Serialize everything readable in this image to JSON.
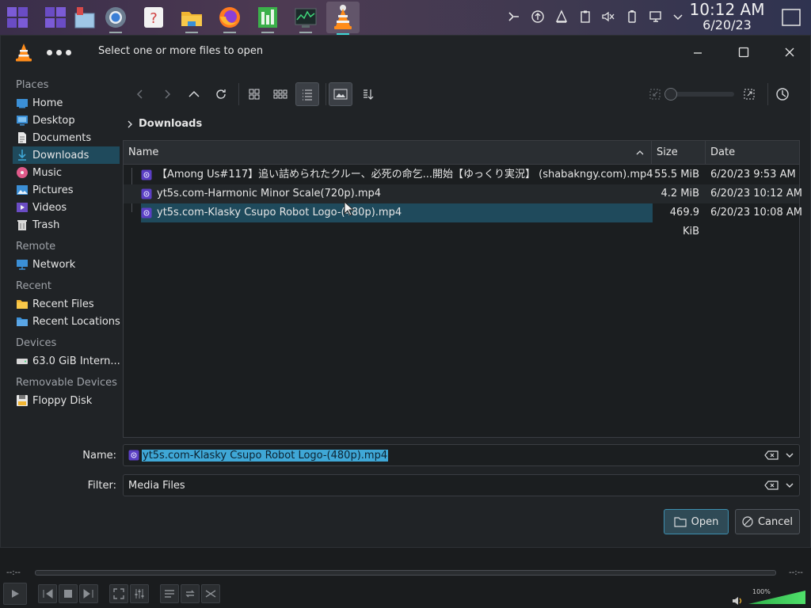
{
  "taskbar": {
    "apps": [
      "pager-icon",
      "pager-icon",
      "show-desktop-icon",
      "chromium-icon",
      "help-icon",
      "file-manager-icon",
      "firefox-icon",
      "spreadsheet-icon",
      "system-monitor-icon",
      "vlc-icon"
    ],
    "clock_time": "10:12 AM",
    "clock_date": "6/20/23"
  },
  "dialog": {
    "title": "Select one or more files to open"
  },
  "places": {
    "sections": [
      {
        "header": "Places",
        "items": [
          "Home",
          "Desktop",
          "Documents",
          "Downloads",
          "Music",
          "Pictures",
          "Videos",
          "Trash"
        ]
      },
      {
        "header": "Remote",
        "items": [
          "Network"
        ]
      },
      {
        "header": "Recent",
        "items": [
          "Recent Files",
          "Recent Locations"
        ]
      },
      {
        "header": "Devices",
        "items": [
          "63.0 GiB Intern..."
        ]
      },
      {
        "header": "Removable Devices",
        "items": [
          "Floppy Disk"
        ]
      }
    ],
    "selected": "Downloads"
  },
  "breadcrumb": "Downloads",
  "columns": {
    "name": "Name",
    "size": "Size",
    "date": "Date"
  },
  "files": [
    {
      "name": "【Among Us#117】追い詰められたクルー、必死の命乞...開始【ゆっくり実況】 (shabakngy.com).mp4",
      "size": "55.5 MiB",
      "date": "6/20/23 9:53 AM"
    },
    {
      "name": "yt5s.com-Harmonic Minor Scale(720p).mp4",
      "size": "4.2 MiB",
      "date": "6/20/23 10:12 AM"
    },
    {
      "name": "yt5s.com-Klasky Csupo Robot Logo-(480p).mp4",
      "size": "469.9 KiB",
      "date": "6/20/23 10:08 AM"
    }
  ],
  "selected_file_index": 2,
  "name_field": {
    "label": "Name:",
    "value": "yt5s.com-Klasky Csupo Robot Logo-(480p).mp4"
  },
  "filter_field": {
    "label": "Filter:",
    "value": "Media Files"
  },
  "buttons": {
    "open": "Open",
    "cancel": "Cancel"
  },
  "player": {
    "time_left": "--:--",
    "time_right": "--:--",
    "volume": "100%"
  },
  "colors": {
    "selection": "#1f4a5c",
    "accent": "#3d8fb0",
    "highlight": "#3fa7d6"
  }
}
